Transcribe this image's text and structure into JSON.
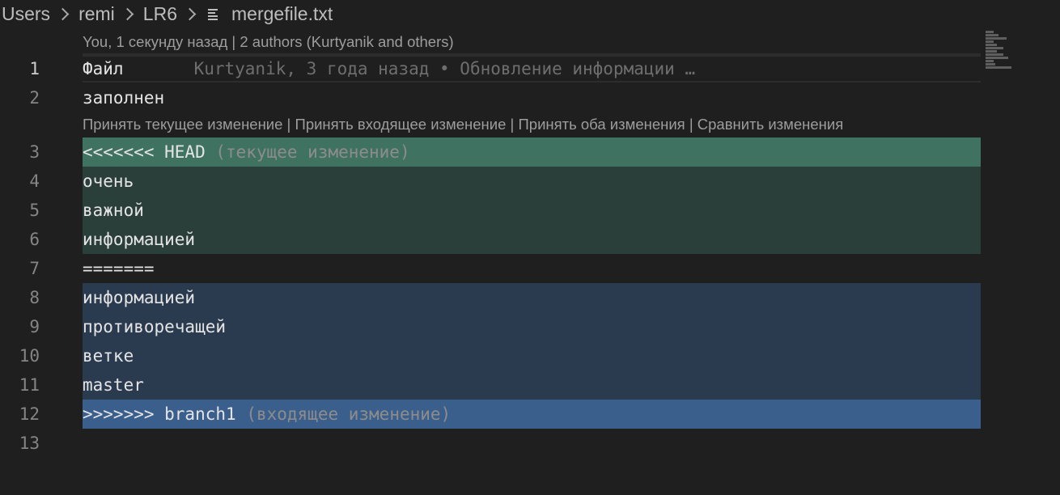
{
  "breadcrumb": {
    "items": [
      "Users",
      "remi",
      "LR6"
    ],
    "file": "mergefile.txt"
  },
  "blame_header": "You, 1 секунду назад | 2 authors (Kurtyanik and others)",
  "inline_blame": "Kurtyanik, 3 года назад • Обновление информации …",
  "codelens": {
    "accept_current": "Принять текущее изменение",
    "accept_incoming": "Принять входящее изменение",
    "accept_both": "Принять оба изменения",
    "compare": "Сравнить изменения",
    "separator": " | "
  },
  "lines": [
    {
      "num": "1",
      "text": "Файл"
    },
    {
      "num": "2",
      "text": "заполнен"
    },
    {
      "num": "3",
      "text": "<<<<<<< HEAD",
      "hint": "(текущее изменение)"
    },
    {
      "num": "4",
      "text": "очень"
    },
    {
      "num": "5",
      "text": "важной"
    },
    {
      "num": "6",
      "text": "информацией"
    },
    {
      "num": "7",
      "text": "======="
    },
    {
      "num": "8",
      "text": "информацией"
    },
    {
      "num": "9",
      "text": "противоречащей"
    },
    {
      "num": "10",
      "text": "ветке"
    },
    {
      "num": "11",
      "text": "master"
    },
    {
      "num": "12",
      "text": ">>>>>>> branch1",
      "hint": "(входящее изменение)"
    },
    {
      "num": "13",
      "text": ""
    }
  ],
  "colors": {
    "editor_bg": "#1f1f1f",
    "current_header": "#407262",
    "current_body": "#2b3f3a",
    "incoming_body": "#2a3a4f",
    "incoming_header": "#3b5f8c"
  }
}
